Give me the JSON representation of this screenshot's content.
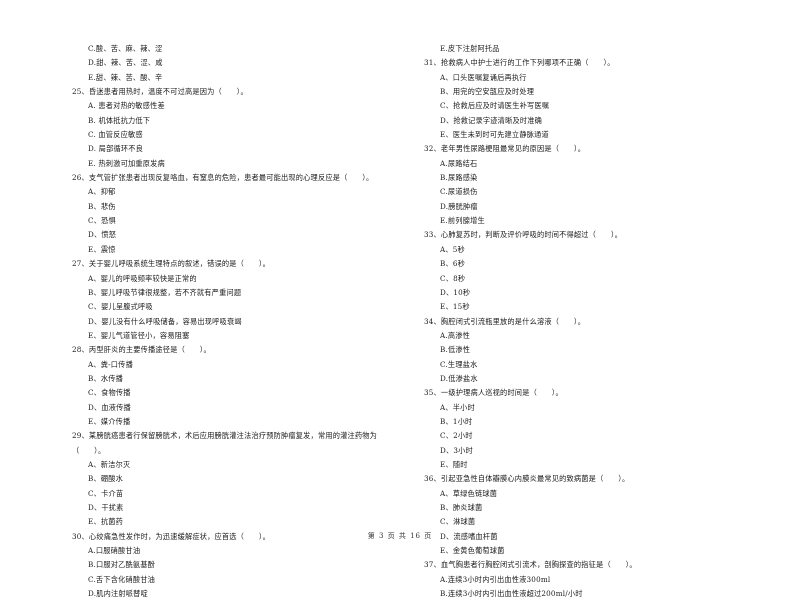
{
  "left_column": [
    {
      "type": "opt",
      "text": "C.酸、苦、麻、辣、涩"
    },
    {
      "type": "opt",
      "text": "D.甜、辣、苦、涩、咸"
    },
    {
      "type": "opt",
      "text": "E.甜、辣、苦、酸、辛"
    },
    {
      "type": "q",
      "text": "25、昏迷患者用热时，温度不可过高是因为（　　）。"
    },
    {
      "type": "opt",
      "text": "A. 患者对热的敏感性差"
    },
    {
      "type": "opt",
      "text": "B. 机体抵抗力低下"
    },
    {
      "type": "opt",
      "text": "C. 血管反应敏感"
    },
    {
      "type": "opt",
      "text": "D. 局部循环不良"
    },
    {
      "type": "opt",
      "text": "E. 热刺激可加重原发病"
    },
    {
      "type": "q",
      "text": "26、支气管扩张患者出现反复咯血，有窒息的危险，患者最可能出现的心理反应是（　　）。"
    },
    {
      "type": "opt",
      "text": "A、抑郁"
    },
    {
      "type": "opt",
      "text": "B、悲伤"
    },
    {
      "type": "opt",
      "text": "C、恐惧"
    },
    {
      "type": "opt",
      "text": "D、愤怒"
    },
    {
      "type": "opt",
      "text": "E、震惊"
    },
    {
      "type": "q",
      "text": "27、关于婴儿呼吸系统生理特点的叙述，错误的是（　　）。"
    },
    {
      "type": "opt",
      "text": "A、婴儿的呼吸频率较快是正常的"
    },
    {
      "type": "opt",
      "text": "B、婴儿呼吸节律很规整，若不齐就有严重问题"
    },
    {
      "type": "opt",
      "text": "C、婴儿呈腹式呼吸"
    },
    {
      "type": "opt",
      "text": "D、婴儿没有什么呼吸储备，容易出现呼吸衰竭"
    },
    {
      "type": "opt",
      "text": "E、婴儿气道管径小，容易阻塞"
    },
    {
      "type": "q",
      "text": "28、丙型肝炎的主要传播途径是（　　）。"
    },
    {
      "type": "opt",
      "text": "A、粪-口传播"
    },
    {
      "type": "opt",
      "text": "B、水传播"
    },
    {
      "type": "opt",
      "text": "C、食物传播"
    },
    {
      "type": "opt",
      "text": "D、血液传播"
    },
    {
      "type": "opt",
      "text": "E、媒介传播"
    },
    {
      "type": "q",
      "text": "29、某膀胱癌患者行保留膀胱术，术后应用膀胱灌注法治疗预防肿瘤复发，常用的灌注药物为"
    },
    {
      "type": "q",
      "text": "（　　）。"
    },
    {
      "type": "opt",
      "text": "A、新洁尔灭"
    },
    {
      "type": "opt",
      "text": "B、硼酸水"
    },
    {
      "type": "opt",
      "text": "C、卡介苗"
    },
    {
      "type": "opt",
      "text": "D、干扰素"
    },
    {
      "type": "opt",
      "text": "E、抗菌药"
    },
    {
      "type": "q",
      "text": "30、心绞痛急性发作时，为迅速缓解症状，应首选（　　）。"
    },
    {
      "type": "opt",
      "text": "A.口服硝酸甘油"
    },
    {
      "type": "opt",
      "text": "B.口服对乙酰氨基酚"
    },
    {
      "type": "opt",
      "text": "C.舌下含化硝酸甘油"
    },
    {
      "type": "opt",
      "text": "D.肌内注射哌替啶"
    }
  ],
  "right_column": [
    {
      "type": "opt",
      "text": "E.皮下注射阿托品"
    },
    {
      "type": "q",
      "text": "31、抢救病人中护士进行的工作下列哪项不正确（　　）。"
    },
    {
      "type": "opt",
      "text": "A、口头医嘱复诵后再执行"
    },
    {
      "type": "opt",
      "text": "B、用完的空安瓿应及时处理"
    },
    {
      "type": "opt",
      "text": "C、抢救后应及时请医生补写医嘱"
    },
    {
      "type": "opt",
      "text": "D、抢救记录字迹清晰及时准确"
    },
    {
      "type": "opt",
      "text": "E、医生未到时可先建立静脉通道"
    },
    {
      "type": "q",
      "text": "32、老年男性尿路梗阻最常见的原因是（　　）。"
    },
    {
      "type": "opt",
      "text": "A.尿路结石"
    },
    {
      "type": "opt",
      "text": "B.尿路感染"
    },
    {
      "type": "opt",
      "text": "C.尿道损伤"
    },
    {
      "type": "opt",
      "text": "D.膀胱肿瘤"
    },
    {
      "type": "opt",
      "text": "E.前列腺增生"
    },
    {
      "type": "q",
      "text": "33、心肺复苏时，判断及评价呼吸的时间不得超过（　　）。"
    },
    {
      "type": "opt",
      "text": "A、5秒"
    },
    {
      "type": "opt",
      "text": "B、6秒"
    },
    {
      "type": "opt",
      "text": "C、8秒"
    },
    {
      "type": "opt",
      "text": "D、10秒"
    },
    {
      "type": "opt",
      "text": "E、15秒"
    },
    {
      "type": "q",
      "text": "34、胸腔闭式引流瓶里放的是什么溶液（　　）。"
    },
    {
      "type": "opt",
      "text": "A.高渗性"
    },
    {
      "type": "opt",
      "text": "B.低渗性"
    },
    {
      "type": "opt",
      "text": "C.生理盐水"
    },
    {
      "type": "opt",
      "text": "D.低渗盐水"
    },
    {
      "type": "q",
      "text": "35、一级护理病人巡视的时间是（　　）。"
    },
    {
      "type": "opt",
      "text": "A、半小时"
    },
    {
      "type": "opt",
      "text": "B、1小时"
    },
    {
      "type": "opt",
      "text": "C、2小时"
    },
    {
      "type": "opt",
      "text": "D、3小时"
    },
    {
      "type": "opt",
      "text": "E、随时"
    },
    {
      "type": "q",
      "text": "36、引起亚急性自体瓣膜心内膜炎最常见的致病菌是（　　）。"
    },
    {
      "type": "opt",
      "text": "A、草绿色链球菌"
    },
    {
      "type": "opt",
      "text": "B、肺炎球菌"
    },
    {
      "type": "opt",
      "text": "C、淋球菌"
    },
    {
      "type": "opt",
      "text": "D、流感嗜血杆菌"
    },
    {
      "type": "opt",
      "text": "E、金黄色葡萄球菌"
    },
    {
      "type": "q",
      "text": "37、血气胸患者行胸腔闭式引流术，剖胸探查的指征是（　　）。"
    },
    {
      "type": "opt",
      "text": "A.连续3小时内引出血性液300ml"
    },
    {
      "type": "opt",
      "text": "B.连续3小时内引出血性液超过200ml/小时"
    }
  ],
  "footer": {
    "page_label": "第 3 页 共 16 页"
  }
}
